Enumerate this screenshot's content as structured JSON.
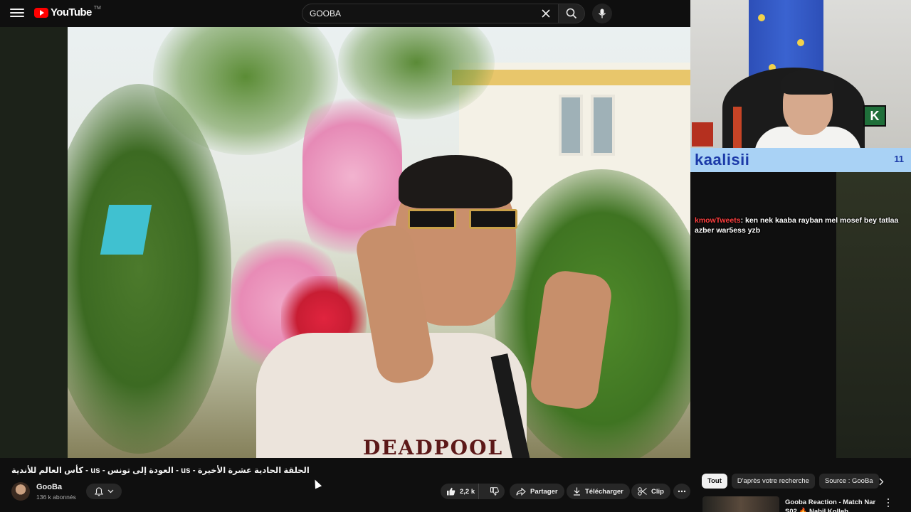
{
  "header": {
    "logo_text": "YouTube",
    "logo_tm": "TM",
    "search_value": "GOOBA"
  },
  "player": {
    "shirt_print": "DEADPOOL",
    "cam_badge": "K",
    "chat_highlight_name": "kaalisii",
    "chat_highlight_count": "11",
    "chat_message_user": "kmowTweets",
    "chat_message_text": ": ken nek kaaba rayban mel mosef bey tatlaa azber war5ess yzb"
  },
  "video": {
    "title": "الحلقة الحادية عشرة الأخيرة - us - العودة إلى تونس - us - كأس العالم للأندية",
    "channel_name": "GooBa",
    "subscribers": "136 k abonnés",
    "likes": "2,2 k",
    "share_label": "Partager",
    "download_label": "Télécharger",
    "clip_label": "Clip"
  },
  "sidebar": {
    "chips": [
      "Tout",
      "D'après votre recherche",
      "Source : GooBa"
    ],
    "recommendation_title": "Gooba Reaction - Match Nar S02 🔥 Nabil Kolleb"
  },
  "colors": {
    "background": "#0f0f0f",
    "brand_red": "#ff0000",
    "chat_banner": "#a9d2f5",
    "pill_bg": "#272727"
  }
}
